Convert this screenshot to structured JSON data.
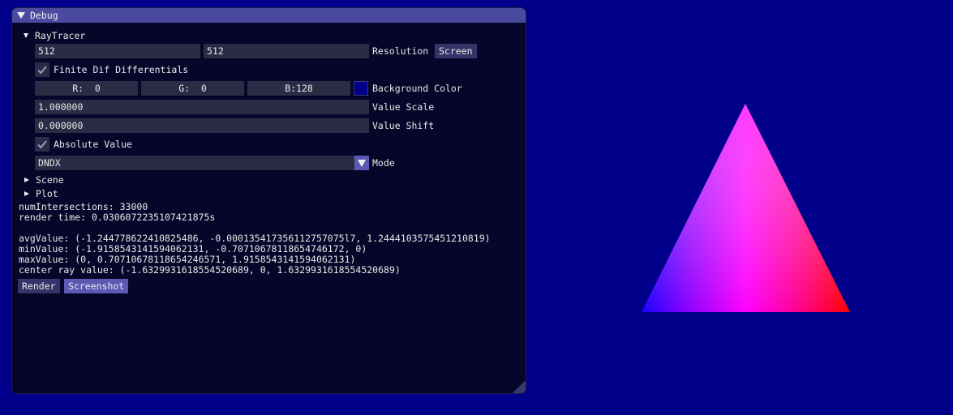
{
  "window": {
    "title": "Debug"
  },
  "raytracer": {
    "header": "RayTracer",
    "resolution": {
      "w": "512",
      "h": "512",
      "label": "Resolution",
      "button": "Screen"
    },
    "finite_dif": {
      "label": "Finite Dif Differentials",
      "checked": true
    },
    "background": {
      "r": "R:  0",
      "g": "G:  0",
      "b": "B:128",
      "label": "Background Color",
      "color": "#000080"
    },
    "value_scale": {
      "value": "1.000000",
      "label": "Value Scale"
    },
    "value_shift": {
      "value": "0.000000",
      "label": "Value Shift"
    },
    "absolute_value": {
      "label": "Absolute Value",
      "checked": true
    },
    "mode": {
      "value": "DNDX",
      "label": "Mode"
    }
  },
  "tree": {
    "scene": "Scene",
    "plot": "Plot"
  },
  "stats": {
    "num_intersections": "numIntersections: 33000",
    "render_time": "render time: 0.0306072235107421875s",
    "avg_value": "avgValue: (-1.244778622410825486, -0.000135417356112757075l7, 1.2444103575451210819)",
    "min_value": "minValue: (-1.9158543141594062131, -0.70710678118654746172, 0)",
    "max_value": "maxValue: (0, 0.70710678118654246571, 1.9158543141594062131)",
    "center_ray": "center ray value: (-1.6329931618554520689, 0, 1.6329931618554520689)"
  },
  "buttons": {
    "render": "Render",
    "screenshot": "Screenshot"
  },
  "colors": {
    "page_bg": "#00008a",
    "window_bg": "#06062a",
    "titlebar": "#4a4a9e",
    "button": "#34346a",
    "button_active": "#5a5ab4"
  },
  "render_preview": {
    "shape": "triangle",
    "corner_colors": [
      "#ff00ff",
      "#0000ff",
      "#ff0000"
    ]
  }
}
